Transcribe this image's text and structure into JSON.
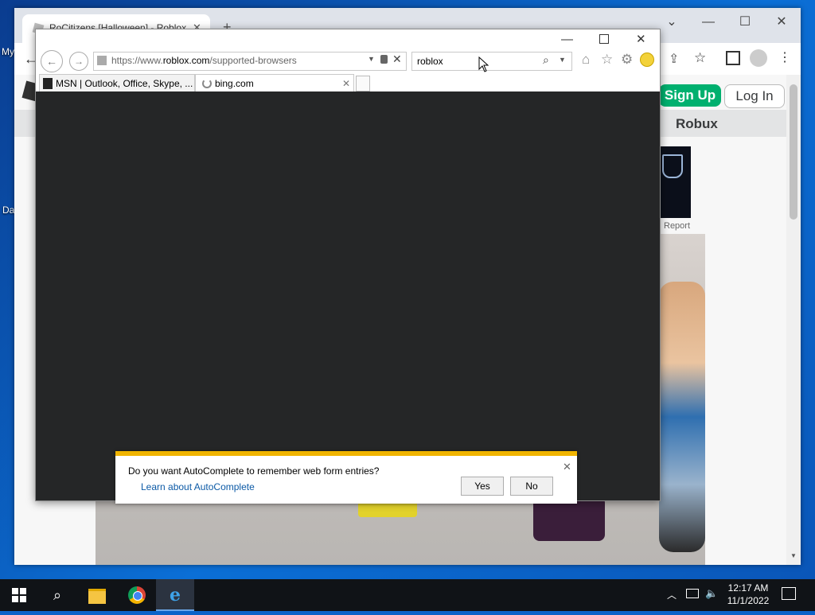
{
  "desktop": {
    "label_1": "My",
    "label_2": "Da"
  },
  "chrome": {
    "tab_title": "RoCitizens [Halloween] - Roblox",
    "signup_label": "Sign Up",
    "login_label": "Log In",
    "robux_label": "Robux",
    "report_label": "Report",
    "accent_green": "#00b06f"
  },
  "ie": {
    "address_url_prefix": "https://www.",
    "address_url_domain": "roblox.com",
    "address_url_path": "/supported-browsers",
    "search_value": "roblox",
    "tabs": [
      {
        "label": "MSN | Outlook, Office, Skype, ..."
      },
      {
        "label": "bing.com"
      }
    ],
    "autocomplete": {
      "question": "Do you want AutoComplete to remember web form entries?",
      "learn_link": "Learn about AutoComplete",
      "yes_label": "Yes",
      "no_label": "No"
    }
  },
  "taskbar": {
    "time": "12:17 AM",
    "date": "11/1/2022"
  },
  "icons": [
    "windows-start-icon",
    "search-icon",
    "file-explorer-icon",
    "chrome-icon",
    "internet-explorer-icon",
    "chevron-up-icon",
    "network-icon",
    "volume-icon",
    "notifications-icon"
  ]
}
